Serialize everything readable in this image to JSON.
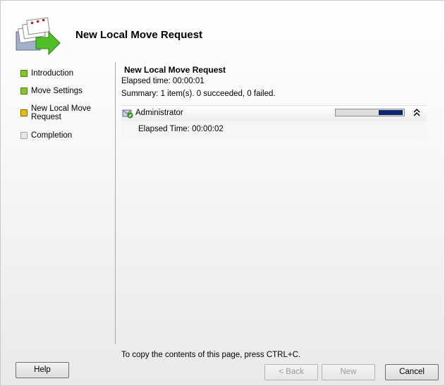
{
  "header": {
    "title": "New Local Move Request",
    "icon": "move-request-wizard-icon"
  },
  "nav": {
    "items": [
      {
        "label": "Introduction",
        "status": "completed",
        "status_color": "#86c62a"
      },
      {
        "label": "Move Settings",
        "status": "completed",
        "status_color": "#86c62a"
      },
      {
        "label": "New Local Move Request",
        "status": "current",
        "status_color": "#e8be12"
      },
      {
        "label": "Completion",
        "status": "pending",
        "status_color": "#e7e7e7"
      }
    ]
  },
  "main": {
    "title": "New Local Move Request",
    "elapsed_time": "Elapsed time: 00:00:01",
    "summary": "Summary: 1 item(s). 0 succeeded, 0 failed.",
    "task": {
      "name": "Administrator",
      "icon": "mailbox-user-icon",
      "progress_fraction": 0.35,
      "detail": "Elapsed Time: 00:00:02"
    }
  },
  "footer": {
    "copy_hint": "To copy the contents of this page, press CTRL+C.",
    "help_label": "Help",
    "back_label": "< Back",
    "new_label": "New",
    "cancel_label": "Cancel"
  }
}
